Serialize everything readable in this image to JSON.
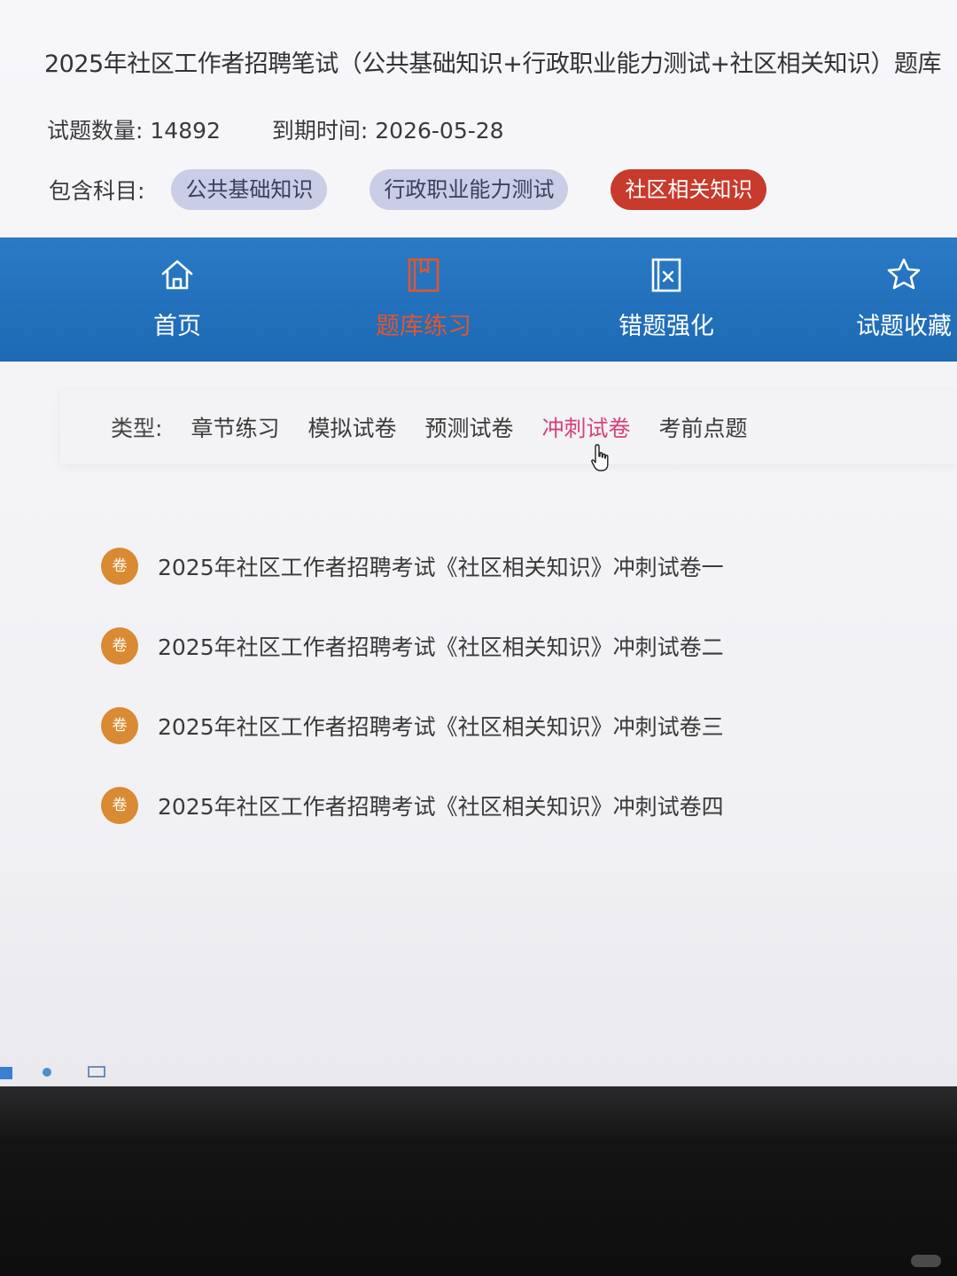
{
  "header": {
    "title": "2025年社区工作者招聘笔试（公共基础知识+行政职业能力测试+社区相关知识）题库",
    "question_count_label": "试题数量:",
    "question_count": "14892",
    "expiry_label": "到期时间:",
    "expiry_date": "2026-05-28",
    "subjects_label": "包含科目:",
    "subjects": [
      {
        "label": "公共基础知识",
        "active": false
      },
      {
        "label": "行政职业能力测试",
        "active": false
      },
      {
        "label": "社区相关知识",
        "active": true
      }
    ]
  },
  "nav": {
    "items": [
      {
        "label": "首页",
        "icon": "home-icon",
        "active": false
      },
      {
        "label": "题库练习",
        "icon": "book-icon",
        "active": true
      },
      {
        "label": "错题强化",
        "icon": "wrong-book-icon",
        "active": false
      },
      {
        "label": "试题收藏",
        "icon": "star-icon",
        "active": false
      }
    ]
  },
  "types": {
    "label": "类型:",
    "options": [
      "章节练习",
      "模拟试卷",
      "预测试卷",
      "冲刺试卷",
      "考前点题"
    ],
    "active": "冲刺试卷"
  },
  "exams": {
    "badge": "卷",
    "items": [
      "2025年社区工作者招聘考试《社区相关知识》冲刺试卷一",
      "2025年社区工作者招聘考试《社区相关知识》冲刺试卷二",
      "2025年社区工作者招聘考试《社区相关知识》冲刺试卷三",
      "2025年社区工作者招聘考试《社区相关知识》冲刺试卷四"
    ]
  },
  "colors": {
    "nav_blue": "#1d69b4",
    "active_orange": "#e0562e",
    "active_pill": "#c83a2c",
    "active_type": "#d7417a",
    "badge": "#d98a33"
  }
}
